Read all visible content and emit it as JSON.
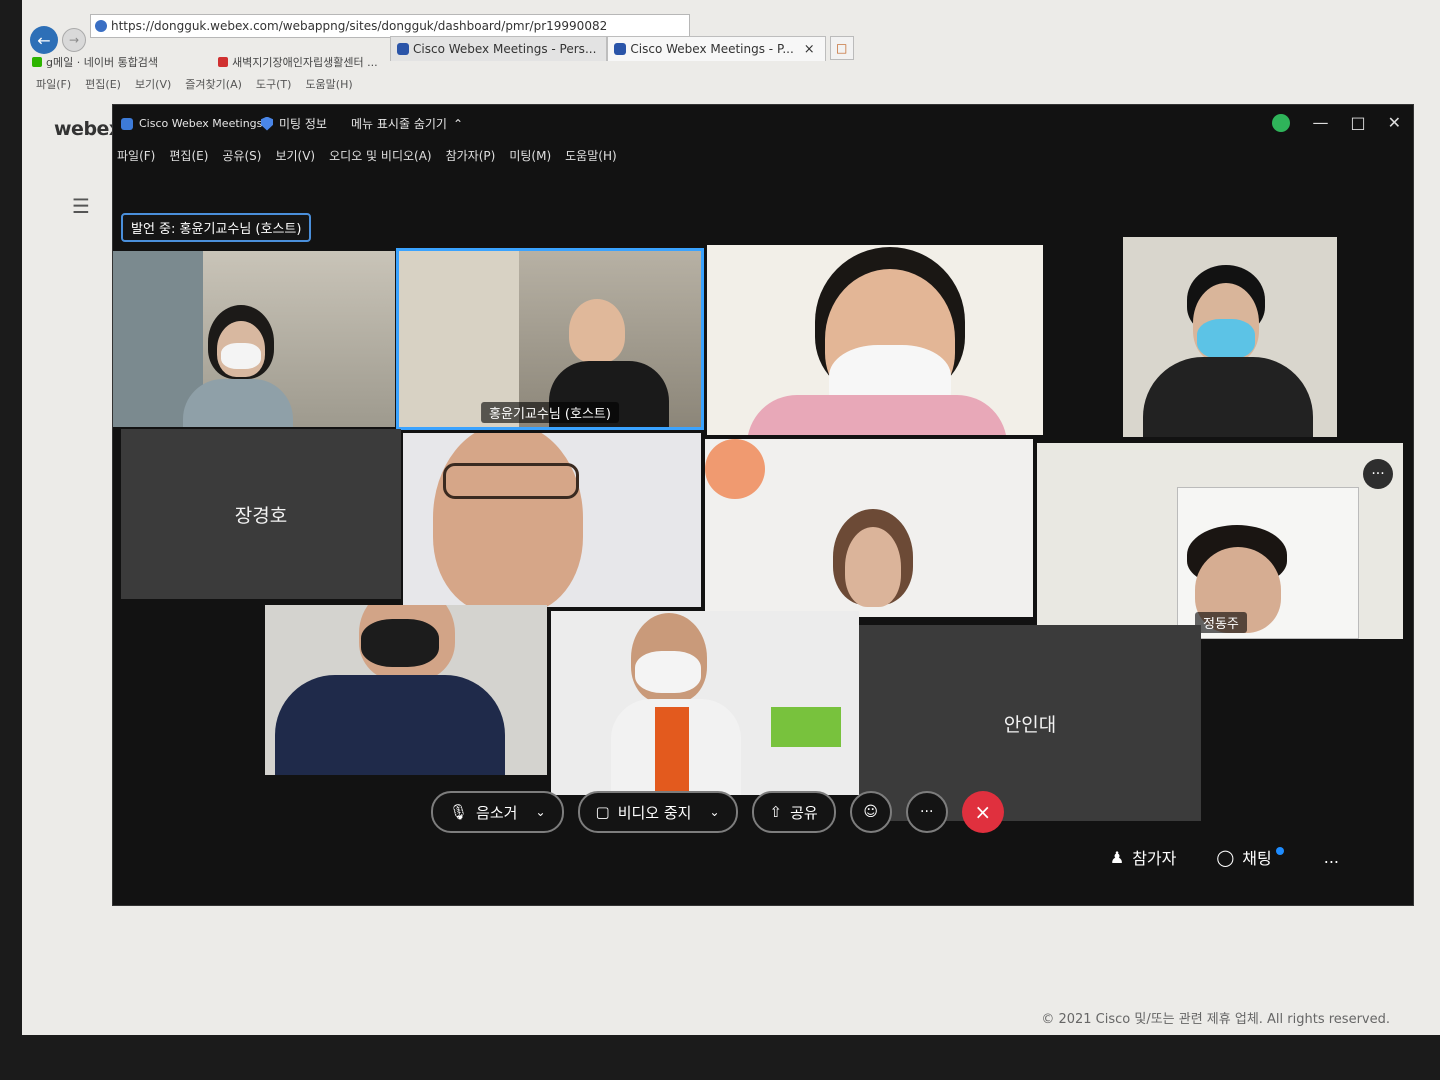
{
  "browser": {
    "url": "https://dongguk.webex.com/webappng/sites/dongguk/dashboard/pmr/pr19990082",
    "tabs": [
      {
        "label": "Cisco Webex Meetings - Pers..."
      },
      {
        "label": "Cisco Webex Meetings - P..."
      }
    ],
    "tab_close": "×",
    "favorites": [
      {
        "label": "g메일 · 네이버 통합검색",
        "color": "#2db400"
      },
      {
        "label": "새벽지기장애인자립생활센터 ...",
        "color": "#d03030"
      }
    ],
    "menu": [
      "파일(F)",
      "편집(E)",
      "보기(V)",
      "즐겨찾기(A)",
      "도구(T)",
      "도움말(H)"
    ]
  },
  "webex": {
    "logo": "webex",
    "app_title": "Cisco Webex Meetings",
    "meeting_info": "미팅 정보",
    "hide_menu": "메뉴 표시줄 숨기기",
    "menu": [
      "파일(F)",
      "편집(E)",
      "공유(S)",
      "보기(V)",
      "오디오 및 비디오(A)",
      "참가자(P)",
      "미팅(M)",
      "도움말(H)"
    ],
    "speaking": "발언 중: 홍윤기교수님 (호스트)",
    "participants": [
      {
        "name": ""
      },
      {
        "name": "홍윤기교수님 (호스트)"
      },
      {
        "name": ""
      },
      {
        "name": ""
      },
      {
        "name": "장경호"
      },
      {
        "name": ""
      },
      {
        "name": ""
      },
      {
        "name": "정동주"
      },
      {
        "name": ""
      },
      {
        "name": ""
      },
      {
        "name": "안인대"
      }
    ],
    "controls": {
      "mute": "음소거",
      "video": "비디오 중지",
      "share": "공유",
      "more": "···",
      "end": "×",
      "participants": "참가자",
      "chat": "채팅",
      "overflow": "..."
    }
  },
  "copyright": "© 2021 Cisco 및/또는 관련 제휴 업체. All rights reserved."
}
